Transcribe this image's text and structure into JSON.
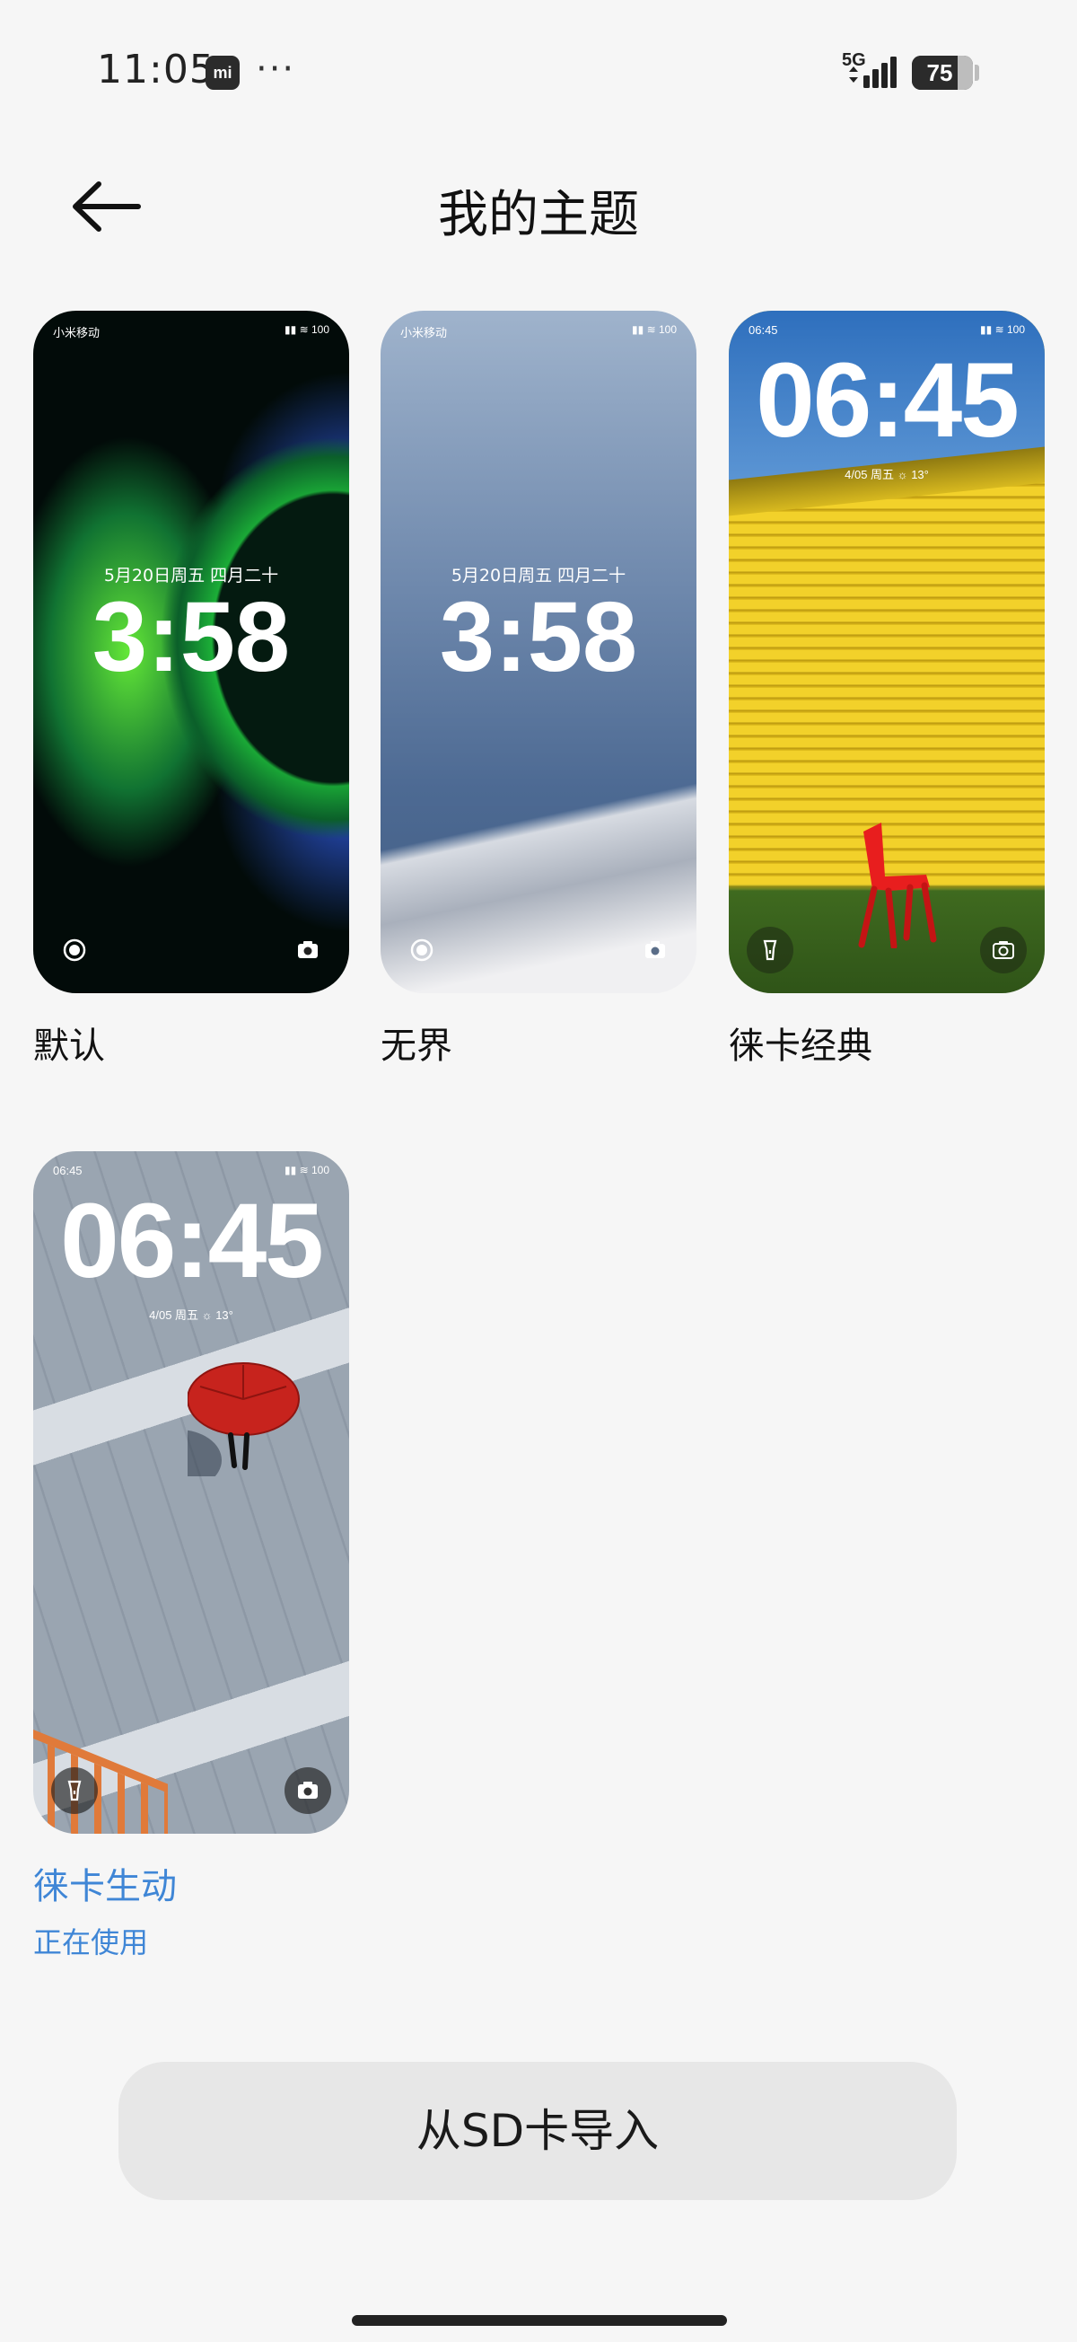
{
  "status_bar": {
    "time": "11:05",
    "mi_badge": "mi",
    "dots": "···",
    "network": "5G",
    "battery": "75"
  },
  "header": {
    "title": "我的主题",
    "back_icon": "arrow-left-icon"
  },
  "themes": [
    {
      "name": "默认",
      "carrier": "小米移动",
      "status_right": "▮▮ ≋ 100",
      "date": "5月20日周五 四月二十",
      "time": "3:58",
      "left_icon": "record-icon",
      "right_icon": "camera-icon",
      "active": false
    },
    {
      "name": "无界",
      "carrier": "小米移动",
      "status_right": "▮▮ ≋ 100",
      "date": "5月20日周五 四月二十",
      "time": "3:58",
      "left_icon": "record-icon",
      "right_icon": "camera-icon",
      "active": false
    },
    {
      "name": "徕卡经典",
      "carrier": "06:45",
      "status_right": "▮▮ ≋ 100",
      "time": "06:45",
      "weather": "4/05 周五 ☼ 13°",
      "left_icon": "flashlight-icon",
      "right_icon": "camera-icon",
      "active": false
    },
    {
      "name": "徕卡生动",
      "carrier": "06:45",
      "status_right": "▮▮ ≋ 100",
      "time": "06:45",
      "weather": "4/05 周五 ☼ 13°",
      "left_icon": "flashlight-icon",
      "right_icon": "camera-icon",
      "active": true,
      "status": "正在使用"
    }
  ],
  "import_button": {
    "label": "从SD卡导入"
  },
  "colors": {
    "accent": "#3f86d6",
    "background": "#f6f6f6",
    "button_bg": "#e7e7e7"
  }
}
